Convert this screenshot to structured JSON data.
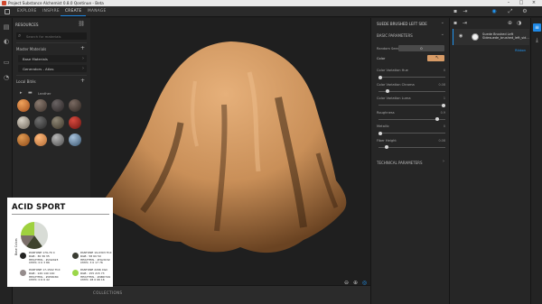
{
  "window": {
    "title": "Project Substance Alchemist 0.8.0 Qontinue - Beta"
  },
  "menu": {
    "tabs": [
      "EXPLORE",
      "INSPIRE",
      "CREATE",
      "MANAGE"
    ],
    "active_tab": "CREATE",
    "accent_color": "#1e88e5"
  },
  "resources": {
    "title": "RESOURCES",
    "search_placeholder": "Search for materials",
    "master_section": "Master Materials",
    "master_items": [
      "Base Materials",
      "Generators - Atlas"
    ],
    "local_section": "Local Bitès",
    "path_label": "Leather"
  },
  "viewport": {
    "fabric_color": "#d49a63"
  },
  "bottom_bar": {
    "collections_label": "COLLECTIONS"
  },
  "overlay_card": {
    "title": "ACID SPORT",
    "axis_label": "Base Colors",
    "chart_data": {
      "type": "pie",
      "title": "",
      "slices": [
        {
          "label": "PANTONE 179-70 C",
          "color": "#d8dcd6",
          "value": 40
        },
        {
          "label": "PANTONE 19-0303 TCX",
          "color": "#3f442e",
          "value": 20
        },
        {
          "label": "PANTONE 17-1502 TCX",
          "color": "#7b6f6a",
          "value": 15
        },
        {
          "label": "PANTONE 2296 XGC",
          "color": "#9fd13f",
          "value": 25
        }
      ]
    },
    "swatches": [
      {
        "name": "PANTONE 179-70 C",
        "rgb": "RGB : 36 36 35",
        "hex": "HEX/HTML : #242423",
        "cmyk": "CMYK: 0 0 3 86",
        "color": "#242423"
      },
      {
        "name": "PANTONE 19-0303 TCX",
        "rgb": "RGB : 58 60 50",
        "hex": "HEX/HTML : #3A3C32",
        "cmyk": "CMYK: 3 0 17 76",
        "color": "#3a3c32"
      },
      {
        "name": "PANTONE 17-1502 TCX",
        "rgb": "RGB : 149 140 140",
        "hex": "HEX/HTML : #958C8C",
        "cmyk": "CMYK: 0 6 6 42",
        "color": "#958c8c"
      },
      {
        "name": "PANTONE 2296 XGC",
        "rgb": "RGB : 155 215 73",
        "hex": "HEX/HTML : #9BD749",
        "cmyk": "CMYK: 28 0 66 16",
        "color": "#9bd749"
      }
    ]
  },
  "properties": {
    "header": "SUEDE BRUSHED LEFT SIDE",
    "basic_section": "BASIC PARAMETERS",
    "technical_section": "TECHNICAL PARAMETERS",
    "random_seed_label": "Random Seed",
    "random_seed_value": "0",
    "color_label": "Color",
    "color_value": "#d79b66",
    "params": [
      {
        "label": "Color Variation Hue",
        "value": "0",
        "level": 0.0
      },
      {
        "label": "Color Variation Chroma",
        "value": "0.08",
        "level": 0.12
      },
      {
        "label": "Color Variation Luma",
        "value": "1",
        "level": 1.0
      },
      {
        "label": "Roughness",
        "value": "0.9",
        "level": 0.9
      },
      {
        "label": "Metallic",
        "value": "0",
        "level": 0.0
      },
      {
        "label": "Fiber Height",
        "value": "0.08",
        "level": 0.1
      }
    ]
  },
  "layers": {
    "layer_name": "Suede Brushed Left Sidesuede_brushed_left_sid...",
    "sub_link": "Ribbon"
  }
}
